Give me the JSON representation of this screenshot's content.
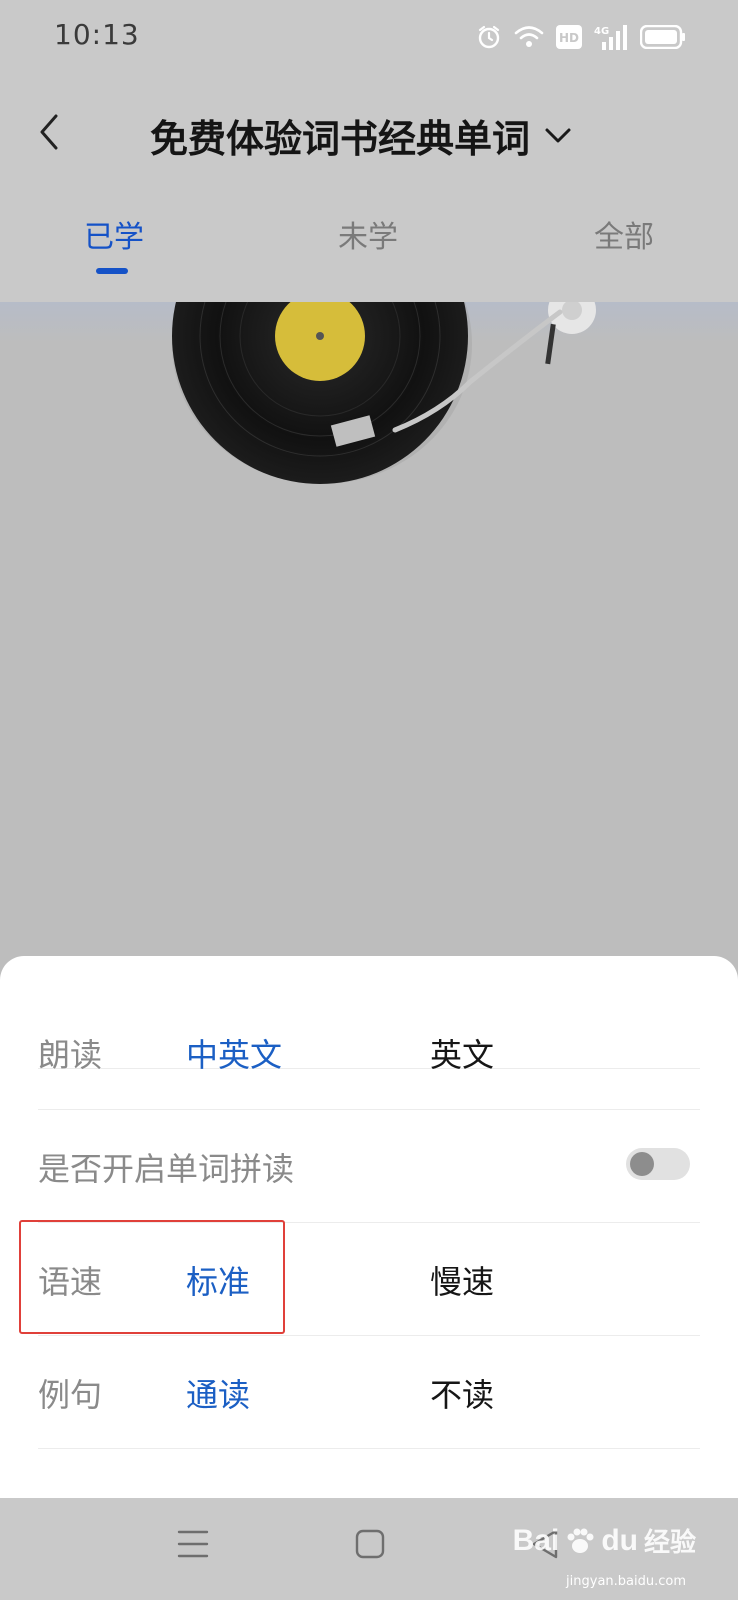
{
  "status_bar": {
    "time": "10:13",
    "icons": [
      "alarm-icon",
      "wifi-icon",
      "hd-icon",
      "4g-signal-icon",
      "battery-icon"
    ],
    "hd_label": "HD",
    "network_label": "4G"
  },
  "header": {
    "title": "免费体验词书经典单词",
    "tabs": [
      {
        "label": "已学",
        "active": true
      },
      {
        "label": "未学",
        "active": false
      },
      {
        "label": "全部",
        "active": false
      }
    ],
    "accent_color": "#1552c7"
  },
  "settings": {
    "reading": {
      "label": "朗读",
      "option_selected": "中英文",
      "option_other": "英文"
    },
    "spelling": {
      "label": "是否开启单词拼读",
      "enabled": false
    },
    "speed": {
      "label": "语速",
      "option_selected": "标准",
      "option_other": "慢速"
    },
    "example": {
      "label": "例句",
      "option_selected": "通读",
      "option_other": "不读"
    }
  },
  "nav_bar": {
    "icons": [
      "menu-icon",
      "home-square-icon",
      "back-triangle-icon"
    ]
  },
  "watermark": {
    "brand": "Bai",
    "brand_suffix": "du",
    "tagline": "经验",
    "url": "jingyan.baidu.com"
  }
}
